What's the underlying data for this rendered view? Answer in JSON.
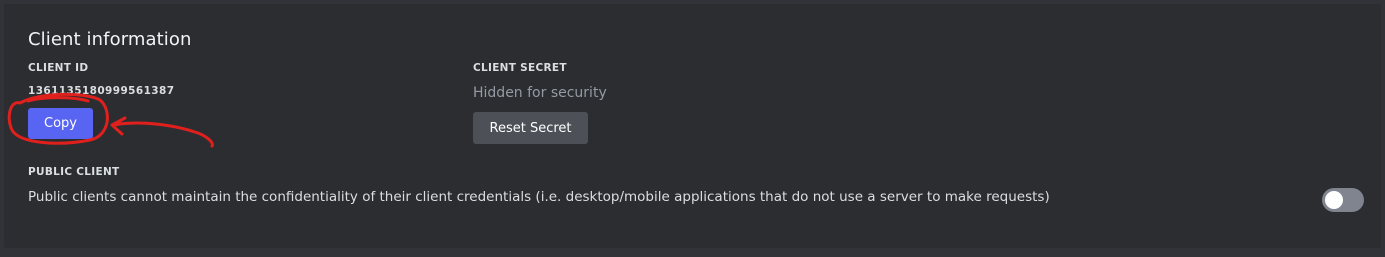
{
  "client_information": {
    "title": "Client information",
    "client_id": {
      "label": "CLIENT ID",
      "value": "1361135180999561387",
      "copy_button_label": "Copy"
    },
    "client_secret": {
      "label": "CLIENT SECRET",
      "value": "Hidden for security",
      "reset_button_label": "Reset Secret"
    },
    "public_client": {
      "label": "PUBLIC CLIENT",
      "description": "Public clients cannot maintain the confidentiality of their client credentials (i.e. desktop/mobile applications that do not use a server to make requests)",
      "enabled": false
    }
  },
  "colors": {
    "background": "#313338",
    "card": "#2b2d31",
    "primary_button": "#5865f2",
    "secondary_button": "#4e5058",
    "toggle_off": "#80848e",
    "annotation": "#e0201d"
  },
  "icons": {
    "annotation": "hand-drawn-circle-and-arrow"
  }
}
